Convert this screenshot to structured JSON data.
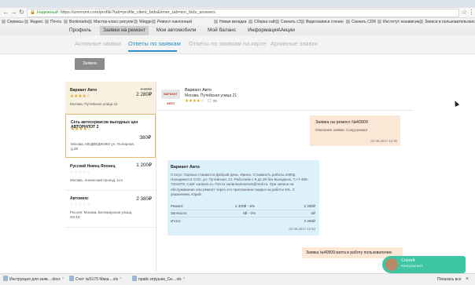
{
  "browser": {
    "secure_label": "Надежный",
    "url": "https://uremont.com/profile?tab=profile_client_bids&inner_tab=inn_bids_answers",
    "bookmarks": [
      "Сервисы",
      "Яндекс",
      "Почта",
      "Bookmarks",
      "Мастер-класс рисуем",
      "Wegge",
      "Ремонт наклонный",
      "Новая вкладка",
      "Сборка сайт",
      "Скачать сЭ",
      "Видеозаписи стенин",
      "Скачать CDR",
      "Институт независим",
      "Записи в пользовательских"
    ]
  },
  "site_nav": {
    "items": [
      "Профиль",
      "Заявки на ремонт",
      "Мои автомобили",
      "Мой баланс",
      "Информация\\Акции"
    ],
    "active_index": 1
  },
  "sub_tabs": {
    "items": [
      "Активные заявки",
      "Ответы по заявкам",
      "Ответы по заявкам на карте",
      "Архивные заявки"
    ],
    "active_index": 1
  },
  "request_badge": "Заявка №40909",
  "answers": [
    {
      "name": "Вариант Авто",
      "stars": "★★★★☆",
      "address": "Москва, Путейская улица 21",
      "price": "2 280₽",
      "old_price": "2 400₽"
    },
    {
      "name": "Сеть автосервисов выгодных цен АВТОРИЛОТ 2",
      "stars": "★★★★☆",
      "address": "Москва, МЕДВЕДКОВО ул. Полярная, д.39",
      "price": "380₽"
    },
    {
      "name": "Русский Немец Японец",
      "stars": "☆☆☆☆☆",
      "address": "Москва, Анненский проезд, 1с4",
      "price": "1 200₽"
    },
    {
      "name": "Автомехс",
      "stars": "☆☆☆☆☆",
      "address": "Россия, Москва, Беломорская улица, 40с18",
      "price": "2 380₽"
    }
  ],
  "chat": {
    "header_name": "Вариант Авто",
    "header_address": "Москва, Путейская улица 21",
    "header_stars": "★★★★☆",
    "comments_count": "35",
    "logo_text": "ВАРИАНТ АВТО",
    "msg1": {
      "title": "Заявка на ремонт №40909",
      "text": "Описание заявки: Сход-развал",
      "date": "02.06.2017 12:30"
    },
    "msg2": {
      "title": "Вариант Авто",
      "text": "Статус: Оценка стоимости Добрый день, Ирина. Стоимость работы 2400р. Находимся в САО, ул. Путейская, 21. Работаем с 9 до 20 без выходных. Т.+7-495-7201676. Сайт variavto.ru. Почта variantavtoservis@mail.ru. При записи на обслуживание или ремонт через это приложение скидка на работы 5%. С уважением, Юрий.",
      "rows": [
        {
          "label": "Ремонт:",
          "a": "2 400₽ - 5%",
          "b": "2 280₽"
        },
        {
          "label": "Запчасти:",
          "a": "0₽ - 0%",
          "b": "0₽"
        },
        {
          "label": "Итого:",
          "a": "",
          "b": "2 280₽"
        }
      ],
      "date": "02.06.2017 12:53"
    },
    "msg3": {
      "title": "Заявка №40909 взята в работу пользователем"
    }
  },
  "consultant": {
    "name": "Сергей",
    "role": "Консультант"
  },
  "downloads": [
    {
      "label": "Инструкция для заяв....docx"
    },
    {
      "label": "Счет №5179 Мака....xls"
    },
    {
      "label": "прайс игрушки_Си....xls"
    }
  ],
  "show_all_label": "Показать все",
  "close_glyph": "×"
}
